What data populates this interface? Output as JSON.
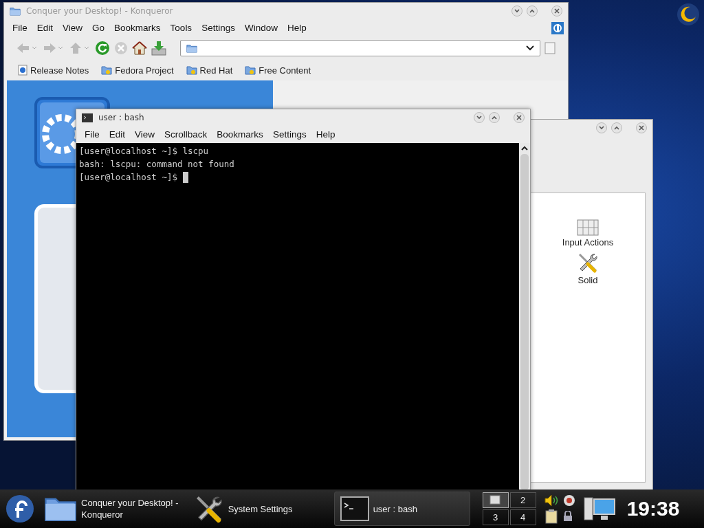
{
  "konqueror": {
    "title": "Conquer your Desktop! - Konqueror",
    "menu": [
      "File",
      "Edit",
      "View",
      "Go",
      "Bookmarks",
      "Tools",
      "Settings",
      "Window",
      "Help"
    ],
    "bookmarks": [
      {
        "label": "Release Notes",
        "kind": "page"
      },
      {
        "label": "Fedora Project",
        "kind": "folder"
      },
      {
        "label": "Red Hat",
        "kind": "folder"
      },
      {
        "label": "Free Content",
        "kind": "folder"
      }
    ]
  },
  "settings_window": {
    "items": [
      {
        "label": "Input Actions",
        "kind": "keyboard"
      },
      {
        "label": "Solid",
        "kind": "tools"
      }
    ]
  },
  "terminal": {
    "title": "user : bash",
    "menu": [
      "File",
      "Edit",
      "View",
      "Scrollback",
      "Bookmarks",
      "Settings",
      "Help"
    ],
    "lines": [
      "[user@localhost ~]$ lscpu",
      "bash: lscpu: command not found",
      "[user@localhost ~]$"
    ]
  },
  "taskbar": {
    "tasks": [
      {
        "label": "Conquer your Desktop! -\nKonqueror",
        "kind": "folder",
        "selected": false
      },
      {
        "label": "System Settings",
        "kind": "tools",
        "selected": false
      },
      {
        "label": "user : bash",
        "kind": "terminal",
        "selected": true
      }
    ],
    "pager": [
      {
        "selected": true
      },
      {
        "label": "2",
        "selected": false
      },
      {
        "label": "3",
        "selected": false
      },
      {
        "label": "4",
        "selected": false
      }
    ],
    "clock": "19:38"
  }
}
